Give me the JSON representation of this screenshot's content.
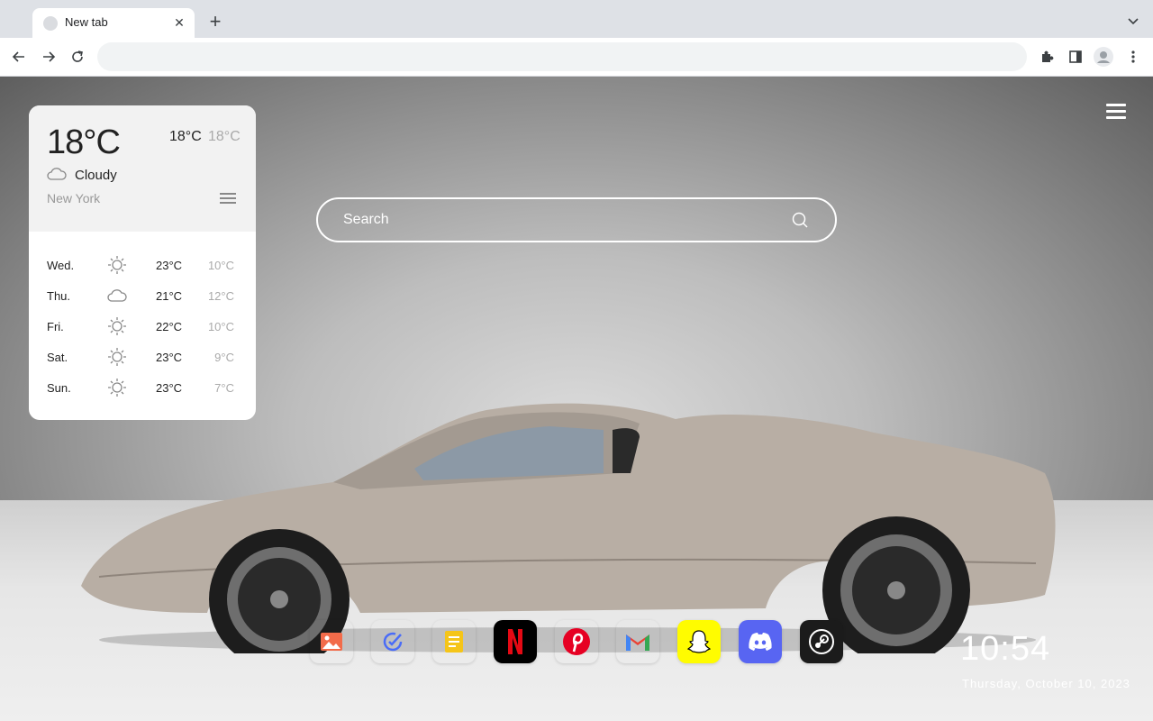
{
  "browser": {
    "tab_title": "New tab",
    "omnibox_value": ""
  },
  "weather": {
    "current_temp": "18°C",
    "high": "18°C",
    "low": "18°C",
    "condition": "Cloudy",
    "city": "New York",
    "forecast": [
      {
        "day": "Wed.",
        "icon": "sun-icon",
        "high": "23°C",
        "low": "10°C"
      },
      {
        "day": "Thu.",
        "icon": "cloud-icon",
        "high": "21°C",
        "low": "12°C"
      },
      {
        "day": "Fri.",
        "icon": "sun-icon",
        "high": "22°C",
        "low": "10°C"
      },
      {
        "day": "Sat.",
        "icon": "sun-icon",
        "high": "23°C",
        "low": "9°C"
      },
      {
        "day": "Sun.",
        "icon": "sun-icon",
        "high": "23°C",
        "low": "7°C"
      }
    ]
  },
  "search": {
    "placeholder": "Search"
  },
  "dock": [
    {
      "name": "photos",
      "bg": "#ffffff"
    },
    {
      "name": "tasks",
      "bg": "#ffffff"
    },
    {
      "name": "notes",
      "bg": "#ffffff"
    },
    {
      "name": "netflix",
      "bg": "#000000"
    },
    {
      "name": "pinterest",
      "bg": "#ffffff"
    },
    {
      "name": "gmail",
      "bg": "#ffffff"
    },
    {
      "name": "snapchat",
      "bg": "#fffc00"
    },
    {
      "name": "discord",
      "bg": "#5865f2"
    },
    {
      "name": "steam",
      "bg": "#1b1b1b"
    }
  ],
  "clock": {
    "time": "10:54",
    "date": "Thursday, October 10, 2023"
  }
}
